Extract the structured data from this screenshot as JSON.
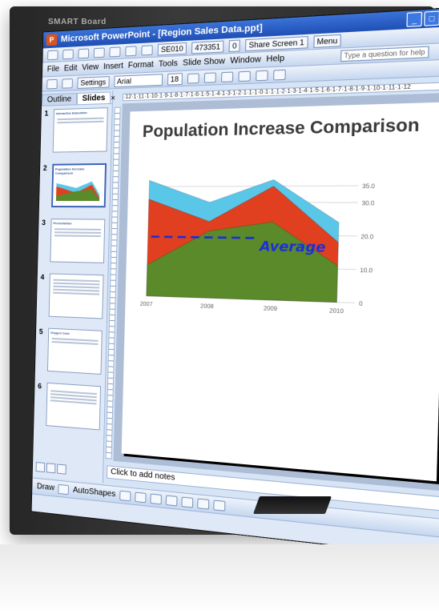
{
  "window": {
    "title": "Microsoft PowerPoint - [Region Sales Data.ppt]",
    "icon": "powerpoint-icon"
  },
  "bezel": {
    "brand": "SMART Board"
  },
  "menubar": {
    "items": [
      "File",
      "Edit",
      "View",
      "Insert",
      "Format",
      "Tools",
      "Slide Show",
      "Window",
      "Help"
    ]
  },
  "toolbar": {
    "settings_label": "Settings",
    "tag1": "SE010",
    "tag2": "473351",
    "count": "0",
    "share_label": "Share Screen",
    "share_num": "1",
    "menu_label": "Menu",
    "font": "Arial",
    "font_size": "18",
    "ask": "Type a question for help"
  },
  "leftpane": {
    "tabs": [
      "Outline",
      "Slides"
    ],
    "active_tab": "Slides",
    "close": "×",
    "slides": [
      {
        "num": "1",
        "title": "Interactive Education"
      },
      {
        "num": "2",
        "title": "Population Increase Comparison"
      },
      {
        "num": "3",
        "title": "Presentation"
      },
      {
        "num": "4",
        "title": ""
      },
      {
        "num": "5",
        "title": "Oxygen Cost"
      },
      {
        "num": "6",
        "title": ""
      }
    ]
  },
  "slide": {
    "title": "Population Increase Comparison",
    "annotation": "Average"
  },
  "chart_data": {
    "type": "area",
    "title": "Population Increase Comparison",
    "x": [
      "2007",
      "2008",
      "2009",
      "2010"
    ],
    "series": [
      {
        "color": "#5bc7e8",
        "values": [
          37,
          30,
          37,
          24
        ]
      },
      {
        "color": "#e0401f",
        "values": [
          31,
          24,
          35,
          18
        ]
      },
      {
        "color": "#5a8a2a",
        "values": [
          10,
          21,
          24,
          11
        ]
      }
    ],
    "y_ticks": [
      "0",
      "10.0",
      "20.0",
      "30.0",
      "35.0"
    ],
    "average_line": 19,
    "grid": true
  },
  "notes": {
    "placeholder": "Click to add notes"
  },
  "drawbar": {
    "draw_label": "Draw",
    "autoshapes_label": "AutoShapes"
  }
}
